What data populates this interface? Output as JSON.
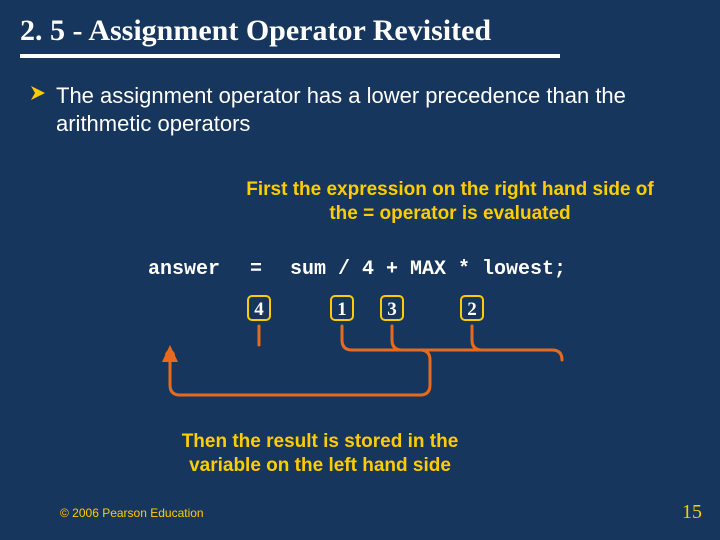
{
  "title": "2. 5 - Assignment Operator Revisited",
  "bullet": {
    "text": "The assignment operator has a lower precedence than the arithmetic operators"
  },
  "captions": {
    "top": "First the expression on the right hand side of the = operator is evaluated",
    "bottom": "Then the result is stored in the variable on the left hand side"
  },
  "code": {
    "answer": "answer",
    "equals": "=",
    "expr": "sum / 4 + MAX * lowest;"
  },
  "order": {
    "box1": "4",
    "box2": "1",
    "box3": "3",
    "box4": "2"
  },
  "footer": {
    "copyright": "© 2006 Pearson Education",
    "page": "15"
  }
}
